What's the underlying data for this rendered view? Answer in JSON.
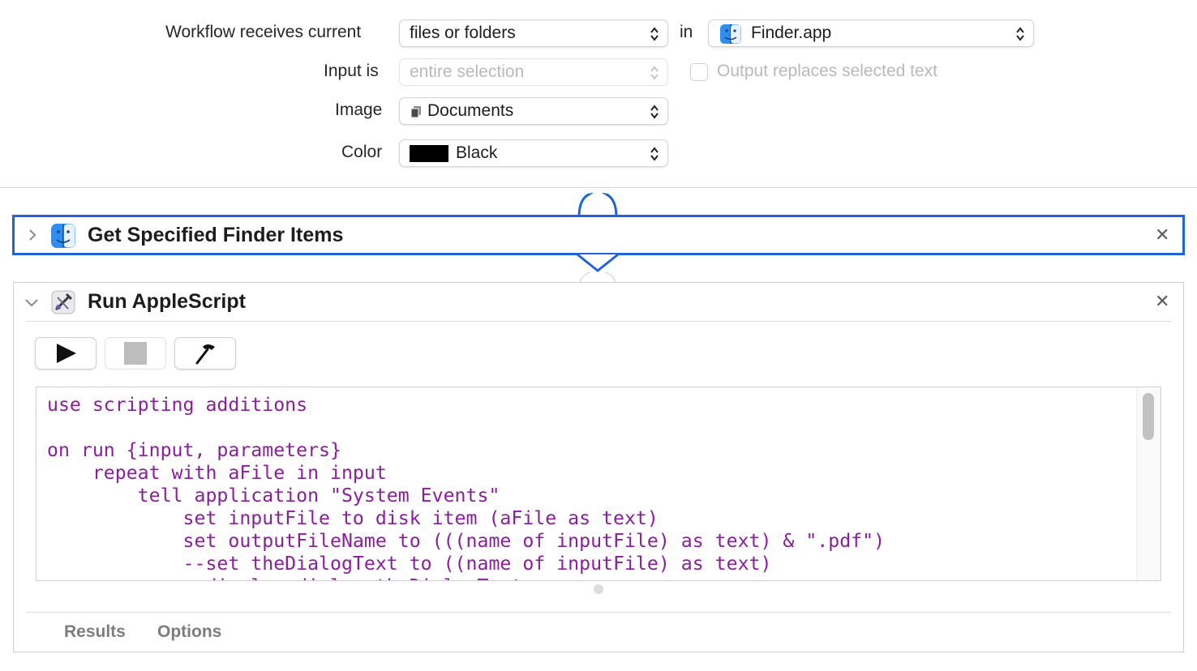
{
  "workflow": {
    "receives_label": "Workflow receives current",
    "receives_value": "files or folders",
    "in_label": "in",
    "app_value": "Finder.app",
    "input_label": "Input is",
    "input_value": "entire selection",
    "output_replaces_label": "Output replaces selected text",
    "image_label": "Image",
    "image_value": "Documents",
    "color_label": "Color",
    "color_value": "Black",
    "color_swatch": "#000000"
  },
  "actions": [
    {
      "title": "Get Specified Finder Items",
      "icon": "finder-icon",
      "collapsed": true
    },
    {
      "title": "Run AppleScript",
      "icon": "applescript-icon",
      "collapsed": false,
      "code": "use scripting additions\n\non run {input, parameters}\n    repeat with aFile in input\n        tell application \"System Events\"\n            set inputFile to disk item (aFile as text)\n            set outputFileName to (((name of inputFile) as text) & \".pdf\")\n            --set theDialogText to ((name of inputFile) as text)\n            --display dialog theDialogText",
      "tabs": [
        "Results",
        "Options"
      ]
    }
  ],
  "colors": {
    "accent": "#1f63d6",
    "code_text": "#8a1e9d"
  }
}
